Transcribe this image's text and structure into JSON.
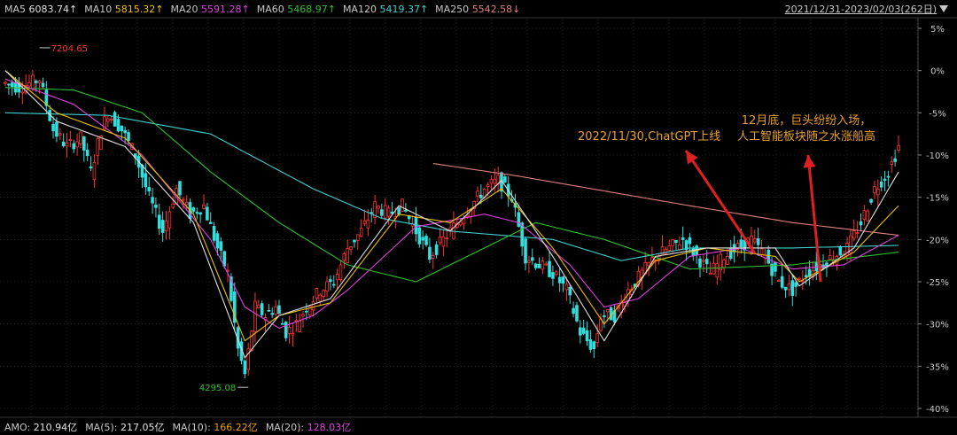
{
  "legend": [
    {
      "label": "MA5",
      "value": "6083.74↑",
      "color": "#e0e0e0"
    },
    {
      "label": "MA10",
      "value": "5815.32↑",
      "color": "#f0c000"
    },
    {
      "label": "MA20",
      "value": "5591.28↑",
      "color": "#e040e0"
    },
    {
      "label": "MA60",
      "value": "5468.97↑",
      "color": "#30c030"
    },
    {
      "label": "MA120",
      "value": "5419.37↑",
      "color": "#40d0d0"
    },
    {
      "label": "MA250",
      "value": "5542.58↓",
      "color": "#e08080"
    }
  ],
  "date_range": "2021/12/31-2023/02/03(262日)",
  "volume_legend": [
    {
      "label": "AMO: ",
      "value": "210.94亿",
      "color": "#e0e0e0"
    },
    {
      "label": "MA(5): ",
      "value": "217.05亿",
      "color": "#e0e0e0"
    },
    {
      "label": "MA(10): ",
      "value": "166.22亿",
      "color": "#f0a000"
    },
    {
      "label": "MA(20): ",
      "value": "128.03亿",
      "color": "#e040e0"
    }
  ],
  "annotations": {
    "chatgpt": "2022/11/30,ChatGPT上线",
    "december_line1": "12月底，巨头纷纷入场，",
    "december_line2": "人工智能板块随之水涨船高"
  },
  "chart_data": {
    "type": "candlestick",
    "x_range": [
      "2021/12/31",
      "2023/02/03"
    ],
    "trading_days": 262,
    "y_axis_ticks": [
      "5%",
      "0%",
      "-5%",
      "-10%",
      "-15%",
      "-20%",
      "-25%",
      "-30%",
      "-35%",
      "-40%"
    ],
    "ylim": [
      -40,
      5
    ],
    "high_label": "7204.65",
    "low_label": "4295.08",
    "ma_latest": {
      "MA5": 6083.74,
      "MA10": 5815.32,
      "MA20": 5591.28,
      "MA60": 5468.97,
      "MA120": 5419.37,
      "MA250": 5542.58
    },
    "colors": {
      "up": "#ff3333",
      "down": "#33dddd",
      "ma5": "#e0e0e0",
      "ma10": "#f0c000",
      "ma20": "#e040e0",
      "ma60": "#30c030",
      "ma120": "#40d0d0",
      "ma250": "#e08080",
      "annotation": "#e8a030"
    },
    "close_path_pct": [
      [
        0,
        -1.5
      ],
      [
        4,
        -2
      ],
      [
        10,
        -1
      ],
      [
        14,
        -7
      ],
      [
        18,
        -9
      ],
      [
        22,
        -8
      ],
      [
        25,
        -12
      ],
      [
        28,
        -7
      ],
      [
        30,
        -5
      ],
      [
        34,
        -7
      ],
      [
        38,
        -10
      ],
      [
        42,
        -15
      ],
      [
        46,
        -19
      ],
      [
        50,
        -14
      ],
      [
        54,
        -17
      ],
      [
        58,
        -16
      ],
      [
        62,
        -21
      ],
      [
        65,
        -24
      ],
      [
        68,
        -33
      ],
      [
        70,
        -36
      ],
      [
        73,
        -28
      ],
      [
        76,
        -29
      ],
      [
        79,
        -28
      ],
      [
        82,
        -31
      ],
      [
        85,
        -30
      ],
      [
        88,
        -28
      ],
      [
        92,
        -26
      ],
      [
        96,
        -25
      ],
      [
        100,
        -21
      ],
      [
        104,
        -19
      ],
      [
        108,
        -16
      ],
      [
        112,
        -17
      ],
      [
        116,
        -16
      ],
      [
        120,
        -19
      ],
      [
        124,
        -22
      ],
      [
        128,
        -20
      ],
      [
        132,
        -18
      ],
      [
        136,
        -16
      ],
      [
        140,
        -14
      ],
      [
        144,
        -13
      ],
      [
        148,
        -15
      ],
      [
        152,
        -22
      ],
      [
        156,
        -23
      ],
      [
        160,
        -24
      ],
      [
        164,
        -26
      ],
      [
        168,
        -31
      ],
      [
        172,
        -33
      ],
      [
        174,
        -29
      ],
      [
        178,
        -29
      ],
      [
        182,
        -26
      ],
      [
        186,
        -24
      ],
      [
        190,
        -22
      ],
      [
        194,
        -21
      ],
      [
        198,
        -20
      ],
      [
        202,
        -22
      ],
      [
        206,
        -24
      ],
      [
        210,
        -22
      ],
      [
        214,
        -21
      ],
      [
        218,
        -20
      ],
      [
        222,
        -22
      ],
      [
        226,
        -25
      ],
      [
        230,
        -26
      ],
      [
        234,
        -24
      ],
      [
        238,
        -23
      ],
      [
        242,
        -22
      ],
      [
        246,
        -21
      ],
      [
        250,
        -18
      ],
      [
        254,
        -14
      ],
      [
        258,
        -12
      ],
      [
        261,
        -9
      ]
    ],
    "ma250_path_pct": [
      [
        125,
        -11
      ],
      [
        150,
        -12.5
      ],
      [
        200,
        -16
      ],
      [
        230,
        -18
      ],
      [
        261,
        -19.5
      ]
    ],
    "ma120_path_pct": [
      [
        0,
        -5
      ],
      [
        30,
        -5.3
      ],
      [
        60,
        -7.5
      ],
      [
        90,
        -14
      ],
      [
        110,
        -17.5
      ],
      [
        130,
        -19
      ],
      [
        160,
        -20
      ],
      [
        180,
        -22.5
      ],
      [
        200,
        -21
      ],
      [
        230,
        -21
      ],
      [
        261,
        -20.7
      ]
    ],
    "ma60_path_pct": [
      [
        0,
        -2
      ],
      [
        20,
        -2.3
      ],
      [
        40,
        -5
      ],
      [
        60,
        -12
      ],
      [
        80,
        -18
      ],
      [
        100,
        -23
      ],
      [
        120,
        -25
      ],
      [
        140,
        -21
      ],
      [
        155,
        -18
      ],
      [
        175,
        -20
      ],
      [
        200,
        -23.5
      ],
      [
        230,
        -23
      ],
      [
        261,
        -21.5
      ]
    ],
    "ma20_path_pct": [
      [
        0,
        -1
      ],
      [
        20,
        -4
      ],
      [
        40,
        -10
      ],
      [
        60,
        -20
      ],
      [
        70,
        -28
      ],
      [
        80,
        -30.5
      ],
      [
        90,
        -29
      ],
      [
        100,
        -26
      ],
      [
        120,
        -18.5
      ],
      [
        140,
        -17
      ],
      [
        150,
        -18
      ],
      [
        165,
        -23
      ],
      [
        175,
        -28
      ],
      [
        185,
        -27
      ],
      [
        200,
        -22
      ],
      [
        215,
        -21
      ],
      [
        230,
        -23.5
      ],
      [
        245,
        -23
      ],
      [
        261,
        -19.5
      ]
    ],
    "ma10_path_pct": [
      [
        0,
        0
      ],
      [
        15,
        -5
      ],
      [
        35,
        -8
      ],
      [
        55,
        -17
      ],
      [
        70,
        -32
      ],
      [
        80,
        -29
      ],
      [
        95,
        -27.5
      ],
      [
        115,
        -17
      ],
      [
        130,
        -18
      ],
      [
        145,
        -14
      ],
      [
        160,
        -21
      ],
      [
        175,
        -30
      ],
      [
        190,
        -22.5
      ],
      [
        205,
        -21
      ],
      [
        225,
        -22
      ],
      [
        232,
        -25
      ],
      [
        248,
        -21.5
      ],
      [
        261,
        -16
      ]
    ],
    "ma5_path_pct": [
      [
        0,
        0
      ],
      [
        15,
        -6
      ],
      [
        35,
        -9
      ],
      [
        55,
        -18
      ],
      [
        70,
        -34
      ],
      [
        80,
        -29
      ],
      [
        95,
        -27
      ],
      [
        115,
        -16
      ],
      [
        130,
        -19
      ],
      [
        145,
        -13
      ],
      [
        160,
        -22
      ],
      [
        175,
        -32
      ],
      [
        190,
        -22
      ],
      [
        205,
        -21
      ],
      [
        225,
        -21
      ],
      [
        232,
        -25.5
      ],
      [
        248,
        -21
      ],
      [
        261,
        -12
      ]
    ]
  }
}
